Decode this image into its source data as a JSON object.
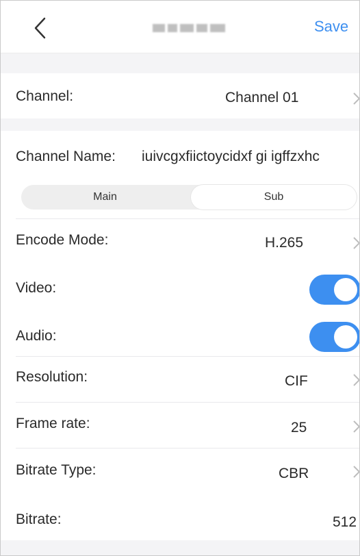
{
  "header": {
    "save_label": "Save"
  },
  "channel": {
    "label": "Channel:",
    "value": "Channel 01"
  },
  "channel_name": {
    "label": "Channel Name:",
    "value": "iuivcgxfiictoycidxf gi igffzxhc"
  },
  "stream_tabs": {
    "main": "Main",
    "sub": "Sub",
    "selected": "Sub"
  },
  "settings": {
    "encode_mode": {
      "label": "Encode Mode:",
      "value": "H.265"
    },
    "video": {
      "label": "Video:",
      "on": true
    },
    "audio": {
      "label": "Audio:",
      "on": true
    },
    "resolution": {
      "label": "Resolution:",
      "value": "CIF"
    },
    "frame_rate": {
      "label": "Frame rate:",
      "value": "25"
    },
    "bitrate_type": {
      "label": "Bitrate Type:",
      "value": "CBR"
    },
    "bitrate": {
      "label": "Bitrate:",
      "value": "512"
    }
  },
  "colors": {
    "accent": "#3d8ff0",
    "background": "#f4f4f6",
    "card": "#ffffff"
  }
}
